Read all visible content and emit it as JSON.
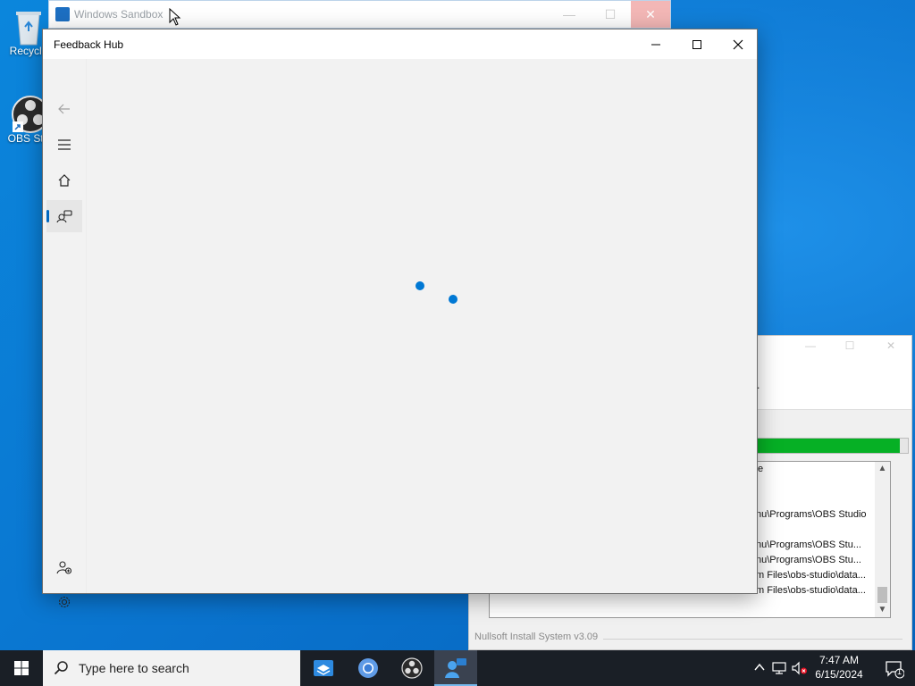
{
  "desktop": {
    "icons": [
      {
        "label": "Recycle",
        "name": "recycle-bin"
      },
      {
        "label": "OBS Stu",
        "name": "obs-studio"
      }
    ]
  },
  "sandbox": {
    "title": "Windows Sandbox"
  },
  "feedback_hub": {
    "title": "Feedback Hub",
    "nav": [
      "back-icon",
      "menu-icon",
      "home-icon",
      "feedback-icon",
      "add-account-icon",
      "settings-icon"
    ]
  },
  "installer": {
    "progress_percent": 98,
    "log_lines": [
      "e",
      "nu\\Programs\\OBS Studio",
      "nu\\Programs\\OBS Stu...",
      "nu\\Programs\\OBS Stu...",
      "m Files\\obs-studio\\data...",
      "m Files\\obs-studio\\data..."
    ],
    "footer": "Nullsoft Install System v3.09",
    "header_fragment": "."
  },
  "taskbar": {
    "search_placeholder": "Type here to search",
    "time": "7:47 AM",
    "date": "6/15/2024",
    "notification_count": "1",
    "apps": [
      "sandbox-app-icon",
      "chrome-app-icon",
      "obs-app-icon",
      "feedback-hub-app-icon"
    ]
  }
}
